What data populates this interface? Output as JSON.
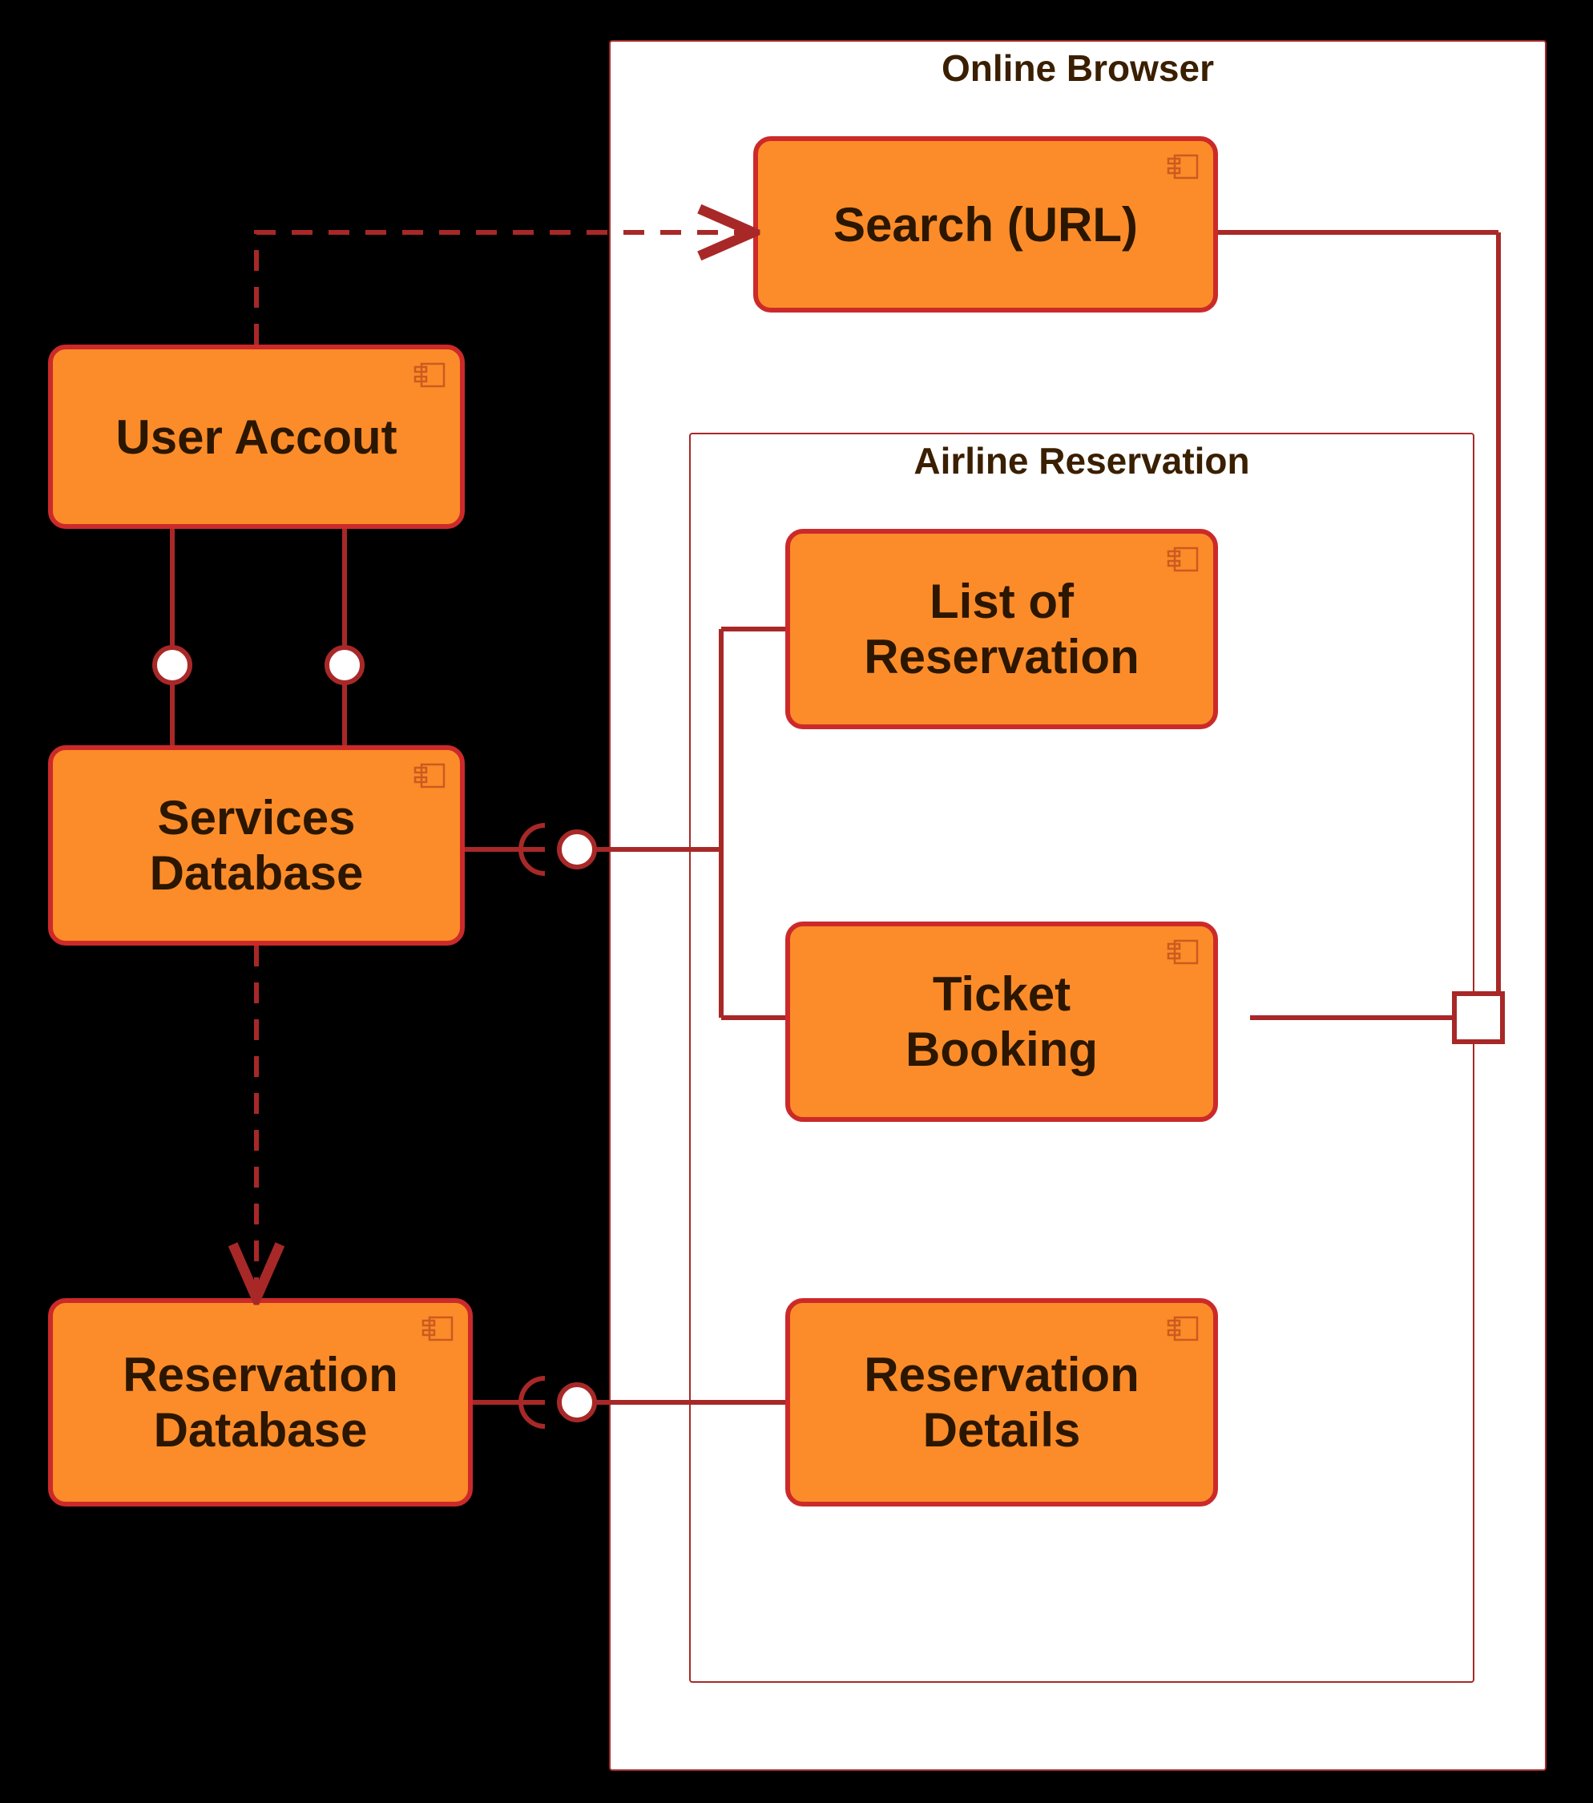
{
  "diagram_type": "UML Component Diagram",
  "colors": {
    "component_fill": "#fb8c29",
    "component_border": "#cc2a2a",
    "frame_fill": "#ffffff",
    "line": "#cc2a2a",
    "background": "#000000"
  },
  "frames": {
    "online_browser": {
      "title": "Online Browser"
    },
    "airline_reservation": {
      "title": "Airline Reservation"
    }
  },
  "components": {
    "user_account": {
      "label": "User Accout"
    },
    "services_database": {
      "label": "Services\nDatabase"
    },
    "reservation_database": {
      "label": "Reservation\nDatabase"
    },
    "search_url": {
      "label": "Search (URL)"
    },
    "list_of_reservation": {
      "label": "List of\nReservation"
    },
    "ticket_booking": {
      "label": "Ticket\nBooking"
    },
    "reservation_details": {
      "label": "Reservation\nDetails"
    }
  },
  "connectors": [
    {
      "from": "user_account",
      "to": "search_url",
      "style": "dashed-arrow"
    },
    {
      "from": "user_account",
      "to": "services_database",
      "style": "two-lollipops"
    },
    {
      "from": "services_database",
      "to": "reservation_database",
      "style": "dashed-arrow"
    },
    {
      "from": "services_database",
      "to": "airline_reservation_left_port",
      "style": "socket-lollipop"
    },
    {
      "from": "reservation_database",
      "to": "reservation_details",
      "style": "socket-lollipop"
    },
    {
      "from": "search_url",
      "to": "ticket_booking_right_port",
      "style": "solid-port"
    }
  ]
}
